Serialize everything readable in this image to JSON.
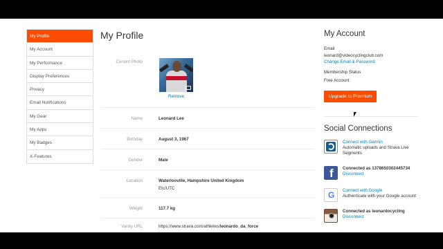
{
  "sidebar": {
    "items": [
      {
        "label": "My Profile",
        "active": true
      },
      {
        "label": "My Account"
      },
      {
        "label": "My Performance"
      },
      {
        "label": "Display Preferences"
      },
      {
        "label": "Privacy"
      },
      {
        "label": "Email Notifications"
      },
      {
        "label": "My Gear"
      },
      {
        "label": "My Apps"
      },
      {
        "label": "My Badges"
      },
      {
        "label": "X-Features"
      }
    ]
  },
  "main": {
    "title": "My Profile",
    "current_photo_label": "Current Photo",
    "remove_label": "Remove",
    "name_label": "Name",
    "name_value": "Leonard Lee",
    "birthday_label": "Birthday",
    "birthday_value": "August 3, 1967",
    "gender_label": "Gender",
    "gender_value": "Male",
    "location_label": "Location",
    "location_value": "Waterlooville, Hampshire United Kingdom",
    "timezone_value": "Etc/UTC",
    "weight_label": "Weight",
    "weight_value": "117.7 kg",
    "vanity_label": "Vanity URL",
    "vanity_prefix": "https://www.strava.com/athletes/",
    "vanity_slug": "leonardo_da_force"
  },
  "account": {
    "title": "My Account",
    "email_label": "Email",
    "email_value": "leonard@videocyclingclub.com",
    "change_link": "Change Email & Password",
    "membership_label": "Membership Status",
    "membership_value": "Free Account",
    "upgrade_button": "Upgrade to Premium"
  },
  "social": {
    "title": "Social Connections",
    "connections": [
      {
        "icon": "garmin-icon",
        "title": "Connect with Garmin",
        "desc": "Automatic uploads and Strava Live Segments"
      },
      {
        "icon": "facebook-icon",
        "title": "Connected as 1378650302445734",
        "desc": "Disconnect"
      },
      {
        "icon": "google-icon",
        "title": "Connect with Google",
        "desc": "Authenticate with your Google account"
      },
      {
        "icon": "instagram-icon",
        "title": "Connected as leonardocycling",
        "desc": "Disconnect"
      }
    ]
  },
  "colors": {
    "accent": "#fc4c02",
    "link": "#007fb6"
  }
}
